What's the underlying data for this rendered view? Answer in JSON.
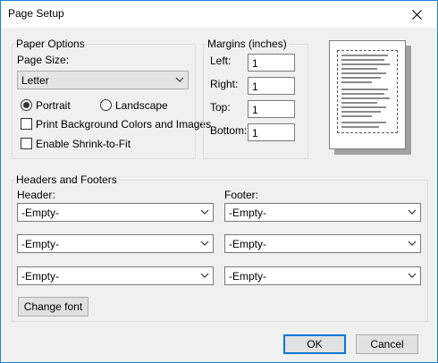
{
  "window": {
    "title": "Page Setup"
  },
  "paper_options": {
    "legend": "Paper Options",
    "size_label": "Page Size:",
    "size_value": "Letter",
    "orientation": {
      "portrait": "Portrait",
      "landscape": "Landscape",
      "selected": "portrait"
    },
    "print_background": "Print Background Colors and Images",
    "shrink_to_fit": "Enable Shrink-to-Fit"
  },
  "margins": {
    "legend": "Margins (inches)",
    "left_label": "Left:",
    "left_value": "1",
    "right_label": "Right:",
    "right_value": "1",
    "top_label": "Top:",
    "top_value": "1",
    "bottom_label": "Bottom:",
    "bottom_value": "1"
  },
  "headers_footers": {
    "legend": "Headers and Footers",
    "header_label": "Header:",
    "footer_label": "Footer:",
    "header_values": [
      "-Empty-",
      "-Empty-",
      "-Empty-"
    ],
    "footer_values": [
      "-Empty-",
      "-Empty-",
      "-Empty-"
    ],
    "change_font": "Change font"
  },
  "buttons": {
    "ok": "OK",
    "cancel": "Cancel"
  },
  "icons": {
    "close": "close-icon",
    "dropdown": "chevron-down-icon"
  }
}
